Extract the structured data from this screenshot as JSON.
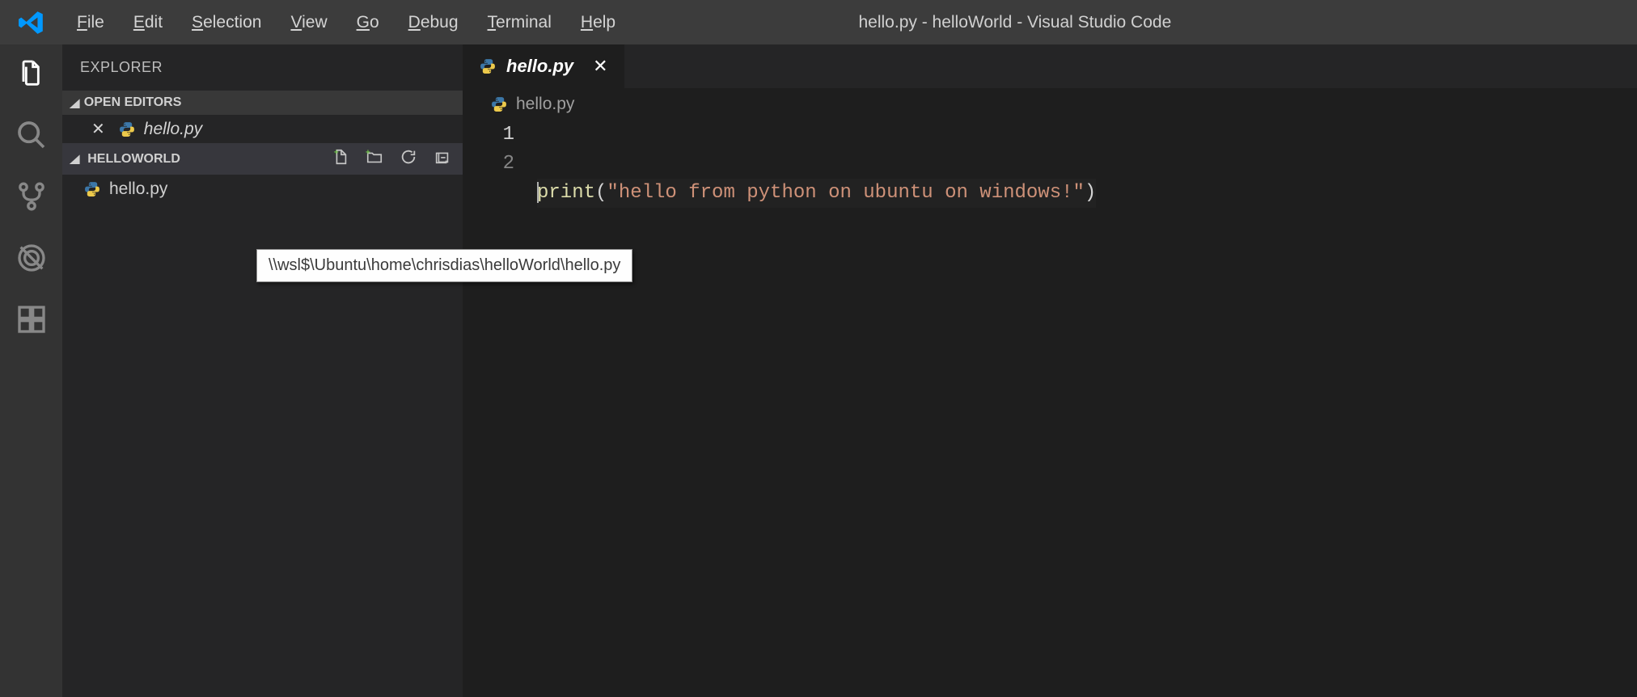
{
  "titlebar": {
    "title": "hello.py - helloWorld - Visual Studio Code",
    "menus": [
      {
        "label": "File",
        "mnemonic": "F"
      },
      {
        "label": "Edit",
        "mnemonic": "E"
      },
      {
        "label": "Selection",
        "mnemonic": "S"
      },
      {
        "label": "View",
        "mnemonic": "V"
      },
      {
        "label": "Go",
        "mnemonic": "G"
      },
      {
        "label": "Debug",
        "mnemonic": "D"
      },
      {
        "label": "Terminal",
        "mnemonic": "T"
      },
      {
        "label": "Help",
        "mnemonic": "H"
      }
    ]
  },
  "activitybar": {
    "items": [
      "explorer",
      "search",
      "source-control",
      "debug",
      "extensions"
    ],
    "active": "explorer"
  },
  "sidebar": {
    "title": "EXPLORER",
    "open_editors": {
      "label": "OPEN EDITORS",
      "files": [
        {
          "name": "hello.py",
          "modified": true
        }
      ]
    },
    "folder": {
      "label": "HELLOWORLD",
      "files": [
        {
          "name": "hello.py"
        }
      ],
      "actions": [
        "new-file",
        "new-folder",
        "refresh",
        "collapse-all"
      ]
    },
    "tooltip": "\\\\wsl$\\Ubuntu\\home\\chrisdias\\helloWorld\\hello.py"
  },
  "editor": {
    "tab": {
      "name": "hello.py",
      "icon": "python"
    },
    "breadcrumb": {
      "name": "hello.py",
      "icon": "python"
    },
    "lines": [
      {
        "n": "1",
        "tokens": [
          {
            "t": "func",
            "v": "print"
          },
          {
            "t": "punc",
            "v": "("
          },
          {
            "t": "str",
            "v": "\"hello from python on ubuntu on windows!\""
          },
          {
            "t": "punc",
            "v": ")"
          }
        ]
      },
      {
        "n": "2",
        "tokens": []
      }
    ]
  }
}
